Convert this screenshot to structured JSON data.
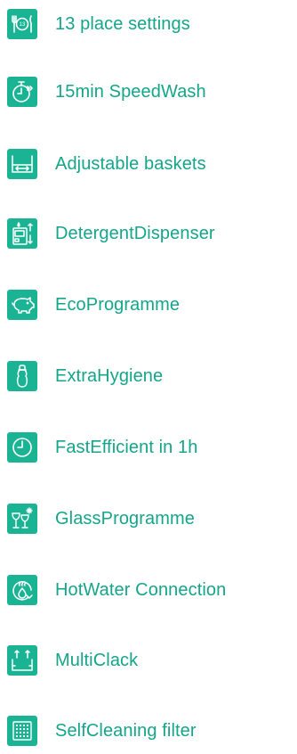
{
  "accent_color": "#1ab394",
  "text_color": "#14a58a",
  "features": [
    {
      "icon": "cutlery-plate-icon",
      "badge": "13",
      "label": "13 place settings"
    },
    {
      "icon": "stopwatch-fast-forward-icon",
      "label": "15min SpeedWash"
    },
    {
      "icon": "adjustable-basket-icon",
      "label": "Adjustable baskets"
    },
    {
      "icon": "detergent-dispenser-icon",
      "label": "DetergentDispenser"
    },
    {
      "icon": "piggy-bank-icon",
      "label": "EcoProgramme"
    },
    {
      "icon": "baby-bottle-icon",
      "label": "ExtraHygiene"
    },
    {
      "icon": "clock-icon",
      "label": "FastEfficient in 1h"
    },
    {
      "icon": "wine-glasses-icon",
      "label": "GlassProgramme"
    },
    {
      "icon": "hot-water-drop-icon",
      "label": "HotWater Connection"
    },
    {
      "icon": "multiclack-basket-icon",
      "label": "MultiClack"
    },
    {
      "icon": "filter-grid-icon",
      "label": "SelfCleaning filter"
    }
  ]
}
